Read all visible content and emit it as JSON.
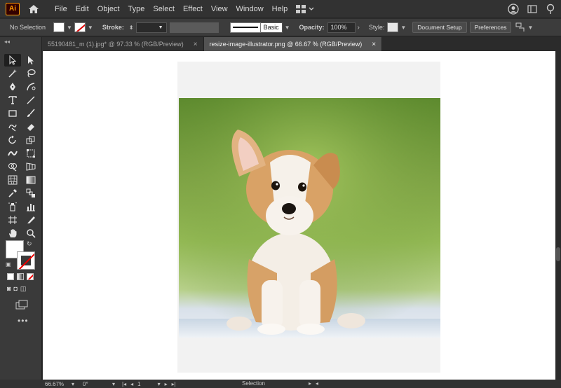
{
  "app": {
    "logo_text": "Ai"
  },
  "menu": {
    "items": [
      "File",
      "Edit",
      "Object",
      "Type",
      "Select",
      "Effect",
      "View",
      "Window",
      "Help"
    ]
  },
  "control_bar": {
    "selection_label": "No Selection",
    "stroke_label": "Stroke:",
    "brush_label": "Basic",
    "opacity_label": "Opacity:",
    "opacity_value": "100%",
    "style_label": "Style:",
    "document_setup_label": "Document Setup",
    "preferences_label": "Preferences"
  },
  "tabs": [
    {
      "label": "55190481_m (1).jpg* @ 97.33 % (RGB/Preview)",
      "active": false
    },
    {
      "label": "resize-image-illustrator.png @ 66.67 % (RGB/Preview)",
      "active": true
    }
  ],
  "status_bar": {
    "zoom": "66.67%",
    "rotation": "0°",
    "artboard_number": "1",
    "tool_status": "Selection"
  },
  "colors": {
    "accent": "#ff9a00",
    "app_bg": "#2b2b2b",
    "panel_bg": "#3a3a3a",
    "canvas_bg": "#ffffff",
    "artboard_bg": "#f2f2f2"
  }
}
